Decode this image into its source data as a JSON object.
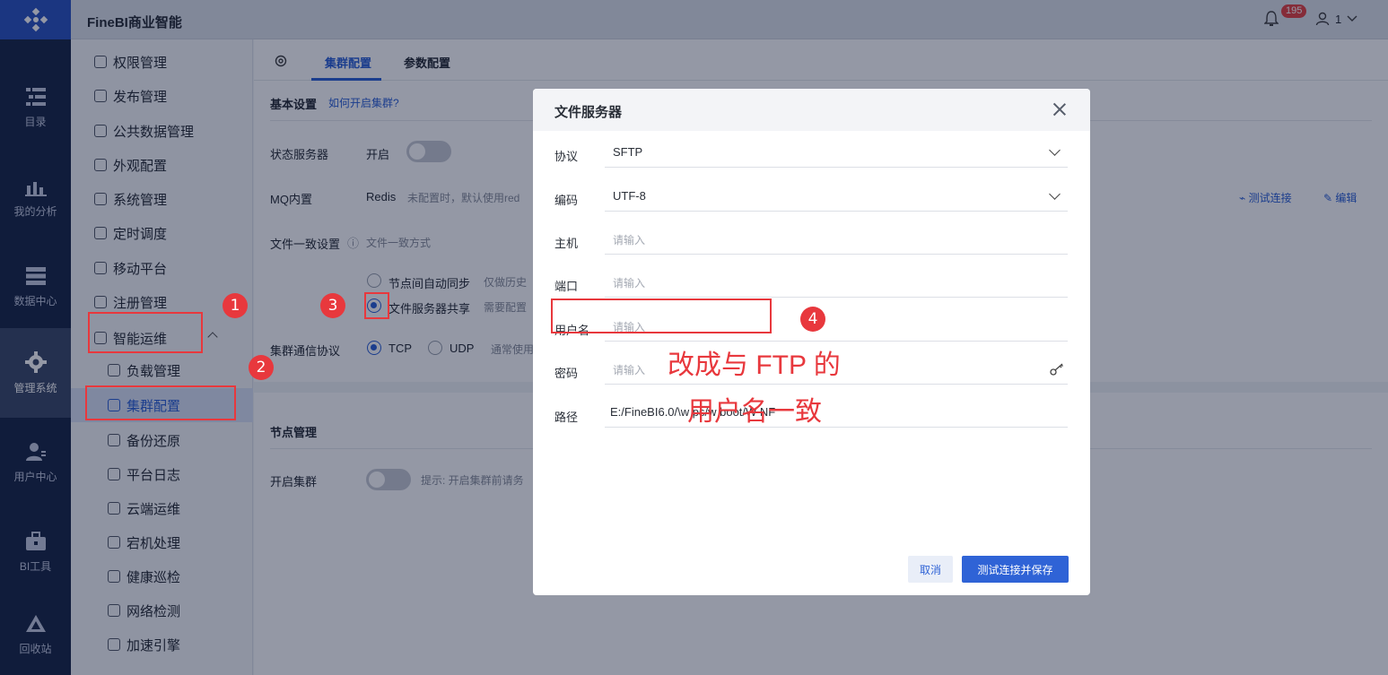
{
  "header": {
    "app_title": "FineBI商业智能",
    "notification_count": "195",
    "user_name": "1"
  },
  "rail": {
    "items": [
      {
        "label": "目录",
        "icon": "catalog-icon"
      },
      {
        "label": "我的分析",
        "icon": "chart-icon"
      },
      {
        "label": "数据中心",
        "icon": "database-icon"
      },
      {
        "label": "管理系统",
        "icon": "gear-icon",
        "active": true
      },
      {
        "label": "用户中心",
        "icon": "user-icon"
      },
      {
        "label": "BI工具",
        "icon": "toolbox-icon"
      },
      {
        "label": "回收站",
        "icon": "recycle-icon"
      }
    ]
  },
  "sidebar": {
    "items": [
      {
        "label": "权限管理"
      },
      {
        "label": "发布管理"
      },
      {
        "label": "公共数据管理"
      },
      {
        "label": "外观配置"
      },
      {
        "label": "系统管理"
      },
      {
        "label": "定时调度"
      },
      {
        "label": "移动平台"
      },
      {
        "label": "注册管理"
      },
      {
        "label": "智能运维"
      },
      {
        "label": "负载管理"
      },
      {
        "label": "集群配置",
        "active": true
      },
      {
        "label": "备份还原"
      },
      {
        "label": "平台日志"
      },
      {
        "label": "云端运维"
      },
      {
        "label": "宕机处理"
      },
      {
        "label": "健康巡检"
      },
      {
        "label": "网络检测"
      },
      {
        "label": "加速引擎"
      }
    ]
  },
  "tabs": [
    {
      "label": "集群配置",
      "active": true
    },
    {
      "label": "参数配置"
    }
  ],
  "main": {
    "basic_settings": "基本设置",
    "how_to_cluster": "如何开启集群?",
    "state_server_label": "状态服务器",
    "state_server_value": "开启",
    "mq_label": "MQ内置",
    "mq_value": "Redis",
    "mq_hint": "未配置时，默认使用red",
    "test_connection": "测试连接",
    "edit": "编辑",
    "file_consistency_label": "文件一致设置",
    "file_consistency_hint": "文件一致方式",
    "option_node_sync": "节点间自动同步",
    "option_node_sync_hint": "仅做历史",
    "option_file_server": "文件服务器共享",
    "option_file_server_hint": "需要配置",
    "protocol_label": "集群通信协议",
    "protocol_tcp": "TCP",
    "protocol_udp": "UDP",
    "protocol_hint": "通常使用",
    "node_management": "节点管理",
    "enable_cluster_label": "开启集群",
    "enable_cluster_hint": "提示: 开启集群前请务"
  },
  "dialog": {
    "title": "文件服务器",
    "fields": [
      {
        "label": "协议",
        "value": "SFTP",
        "type": "select"
      },
      {
        "label": "编码",
        "value": "UTF-8",
        "type": "select"
      },
      {
        "label": "主机",
        "placeholder": "请输入"
      },
      {
        "label": "端口",
        "placeholder": "请输入"
      },
      {
        "label": "用户名",
        "placeholder": "请输入"
      },
      {
        "label": "密码",
        "placeholder": "请输入"
      },
      {
        "label": "路径",
        "value": "E:/FineBI6.0/\\w  ps/w  boot/W  NF"
      }
    ],
    "cancel": "取消",
    "save": "测试连接并保存"
  },
  "annotations": {
    "numbers": [
      "1",
      "2",
      "3",
      "4"
    ],
    "text_line1": "改成与 FTP 的",
    "text_line2": "用户名一致",
    "color": "#e8383d"
  }
}
